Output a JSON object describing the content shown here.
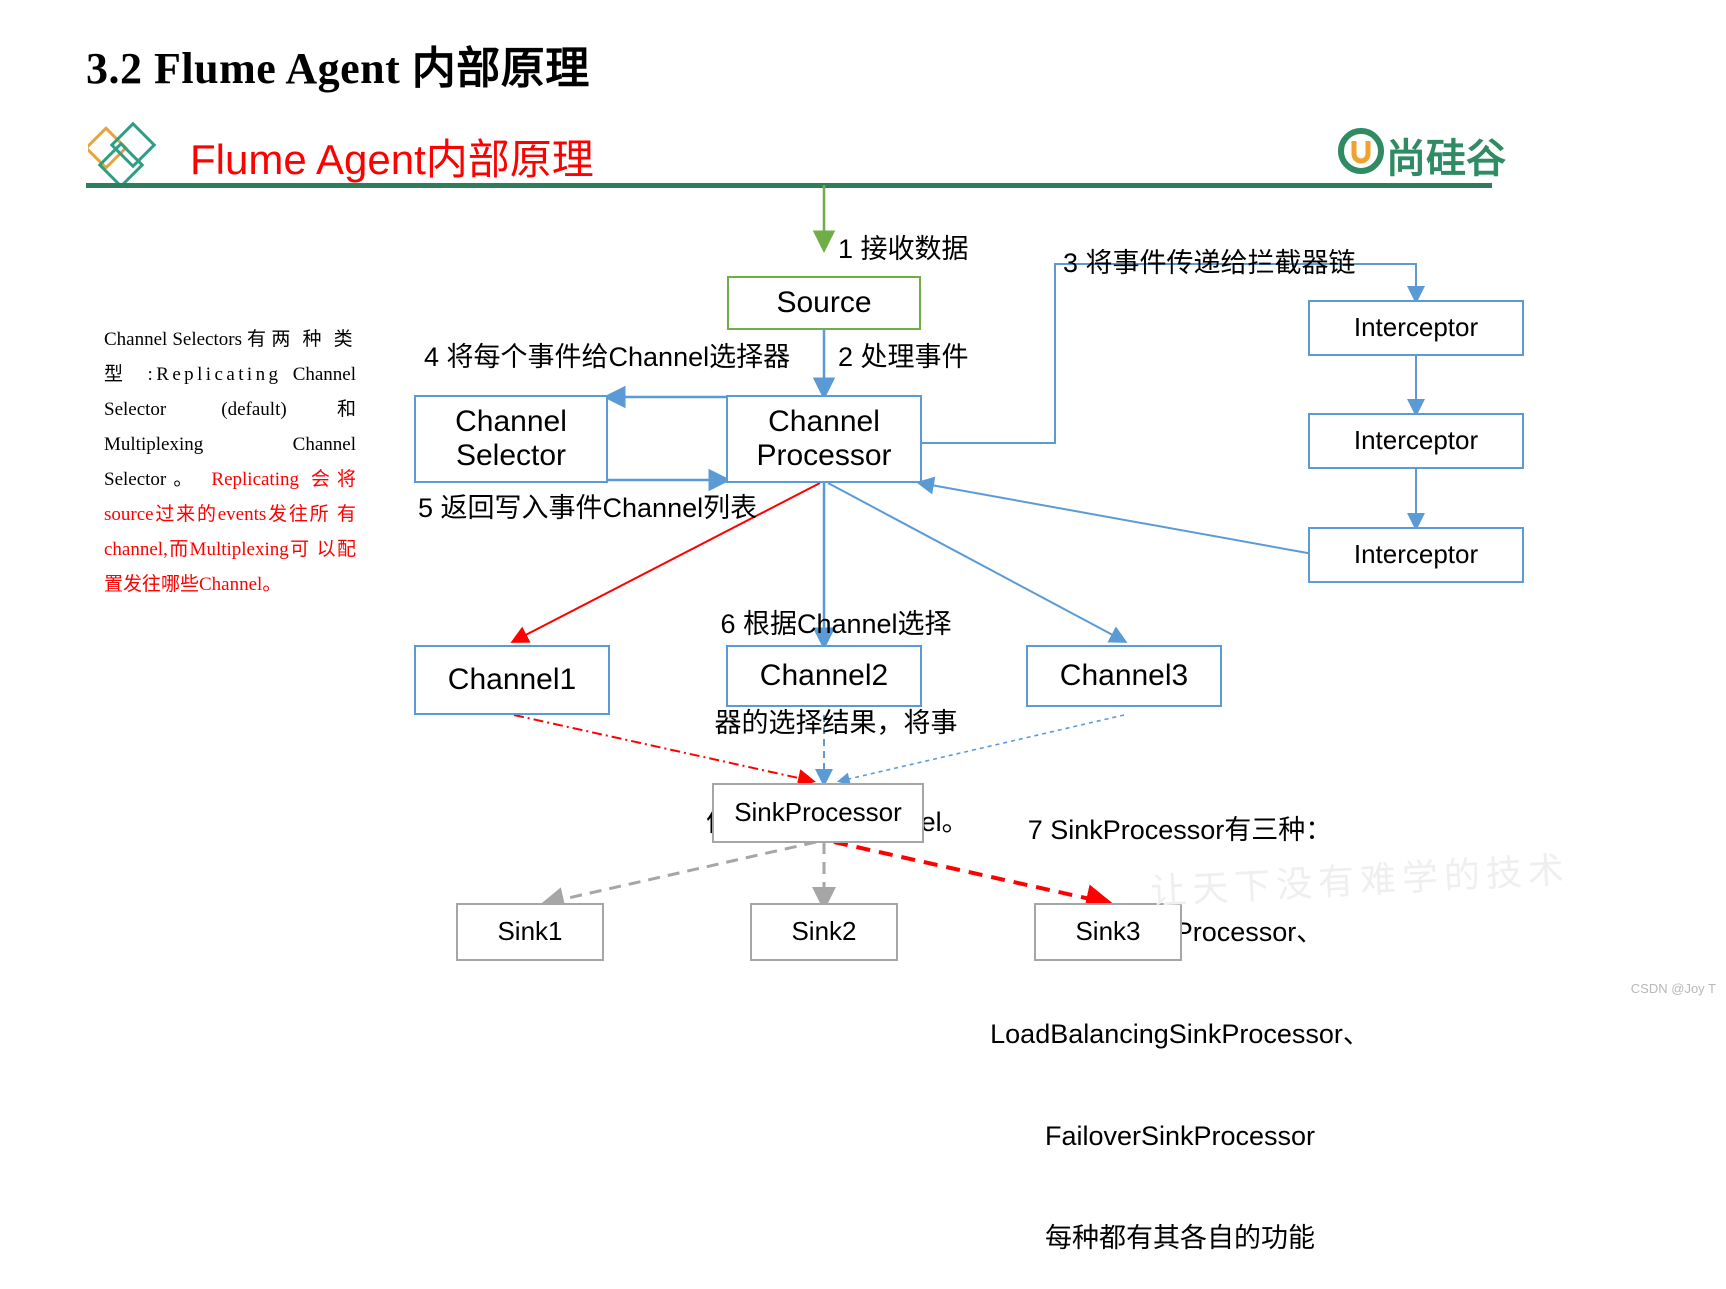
{
  "page": {
    "title": "3.2 Flume Agent 内部原理",
    "banner_title": "Flume Agent内部原理",
    "brand_logo_text": "尚硅谷",
    "watermark": "让天下没有难学的技术",
    "credit": "CSDN @Joy T",
    "accent_green": "#2e7d5b",
    "accent_red": "#ff0000",
    "box_blue": "#5b9bd5",
    "box_green": "#70ad47",
    "box_grey": "#a6a6a6"
  },
  "notes": {
    "selector_black_1": "Channel  Selectors 有",
    "selector_black_2": "两 种 类 型 :Replicating",
    "selector_black_3": "Channel  Selector  (default)和",
    "selector_black_4": "Multiplexing              Channel",
    "selector_black_5": "Selector。",
    "selector_red_1": "Replicating  会将",
    "selector_red_2": "source过来的events发往所",
    "selector_red_3": "有channel,而Multiplexing可",
    "selector_red_4": "以配置发往哪些Channel。",
    "step1": "1 接收数据",
    "step2": "2 处理事件",
    "step3": "3 将事件传递给拦截器链",
    "step4": "4 将每个事件给Channel选择器",
    "step5": "5 返回写入事件Channel列表",
    "step6_line1": "6 根据Channel选择",
    "step6_line2": "器的选择结果，将事",
    "step6_line3": "件写入相应Channel。",
    "step7_line1": "7 SinkProcessor有三种：",
    "step7_line2": "DefaultSinkProcessor、",
    "step7_line3": "LoadBalancingSinkProcessor、",
    "step7_line4": "FailoverSinkProcessor",
    "step7_line5": "每种都有其各自的功能"
  },
  "nodes": {
    "source": "Source",
    "channel_selector_line1": "Channel",
    "channel_selector_line2": "Selector",
    "channel_processor_line1": "Channel",
    "channel_processor_line2": "Processor",
    "interceptor1": "Interceptor",
    "interceptor2": "Interceptor",
    "interceptor3": "Interceptor",
    "channel1": "Channel1",
    "channel2": "Channel2",
    "channel3": "Channel3",
    "sink_processor": "SinkProcessor",
    "sink1": "Sink1",
    "sink2": "Sink2",
    "sink3": "Sink3"
  }
}
